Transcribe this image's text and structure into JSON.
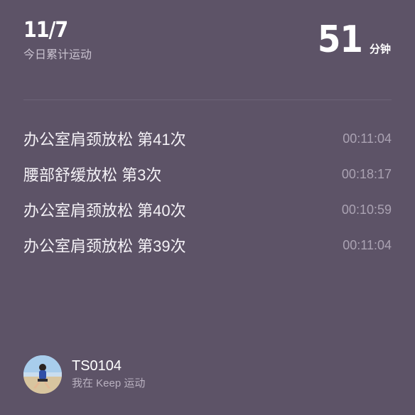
{
  "header": {
    "date": "11/7",
    "subtitle": "今日累计运动",
    "total_value": "51",
    "total_unit": "分钟"
  },
  "records": [
    {
      "name": "办公室肩颈放松 第41次",
      "time": "00:11:04"
    },
    {
      "name": "腰部舒缓放松 第3次",
      "time": "00:18:17"
    },
    {
      "name": "办公室肩颈放松 第40次",
      "time": "00:10:59"
    },
    {
      "name": "办公室肩颈放松 第39次",
      "time": "00:11:04"
    }
  ],
  "profile": {
    "username": "TS0104",
    "caption": "我在 Keep 运动"
  },
  "colors": {
    "background": "#5d5367",
    "primary_text": "#ffffff",
    "secondary_text": "#aaa2b2"
  }
}
